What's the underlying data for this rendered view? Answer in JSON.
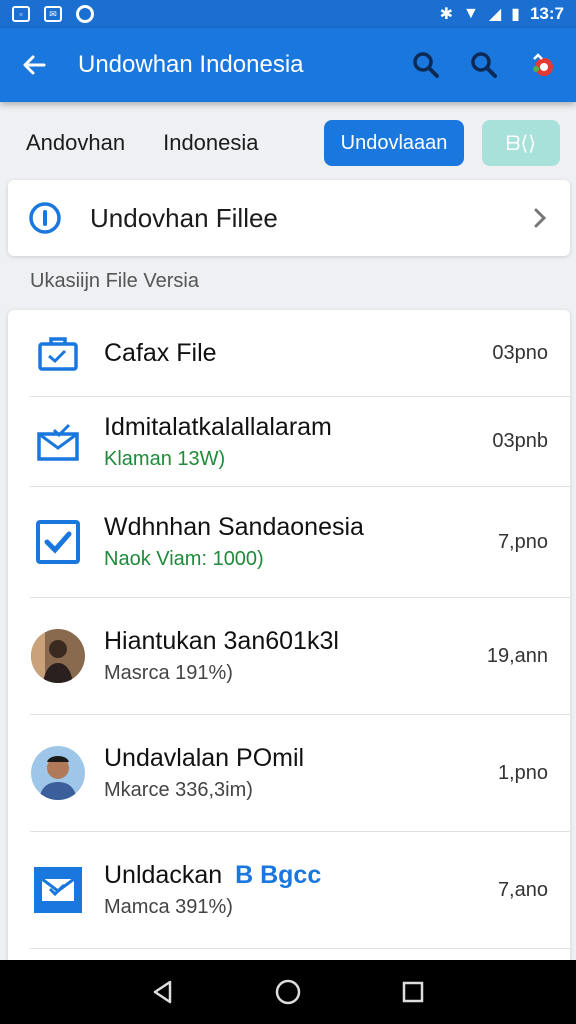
{
  "status_bar": {
    "time": "13:7"
  },
  "app_bar": {
    "title": "Undowhan Indonesia"
  },
  "tabs": {
    "items": [
      "Andovhan",
      "Indonesia"
    ],
    "primary_button": "Undovlaaan",
    "secondary_button": "ᗷ⟨⟩"
  },
  "file_card": {
    "title": "Undovhan Fillee"
  },
  "section_label": "Ukasiijn File Versia",
  "rows": [
    {
      "title": "Cafax File",
      "subtitle": "",
      "time": "03pno",
      "icon": "briefcase-icon"
    },
    {
      "title": "Idmitalatkalallalaram",
      "subtitle": "Klaman 13W)",
      "time": "03pnb",
      "icon": "mail-check-icon"
    },
    {
      "title": "Wdhnhan Sandaonesia",
      "subtitle": "Naok Viam: 1000)",
      "time": "7,pno",
      "icon": "checkbox-icon"
    },
    {
      "title": "Hiantukan 3an601k3l",
      "subtitle": "Masrca 191%)",
      "time": "19,ann",
      "icon": "avatar-icon"
    },
    {
      "title": "Undavlalan POmil",
      "subtitle": "Mkarce 336,3im)",
      "time": "1,pno",
      "icon": "avatar-icon"
    },
    {
      "title": "Unldackan",
      "title_badge": "B Bgcc",
      "subtitle": "Mamca 391%)",
      "time": "7,ano",
      "icon": "mail-icon"
    }
  ],
  "colors": {
    "primary": "#1a77dd",
    "accent_green": "#1f8a3a",
    "secondary_button": "#a8e0da"
  }
}
